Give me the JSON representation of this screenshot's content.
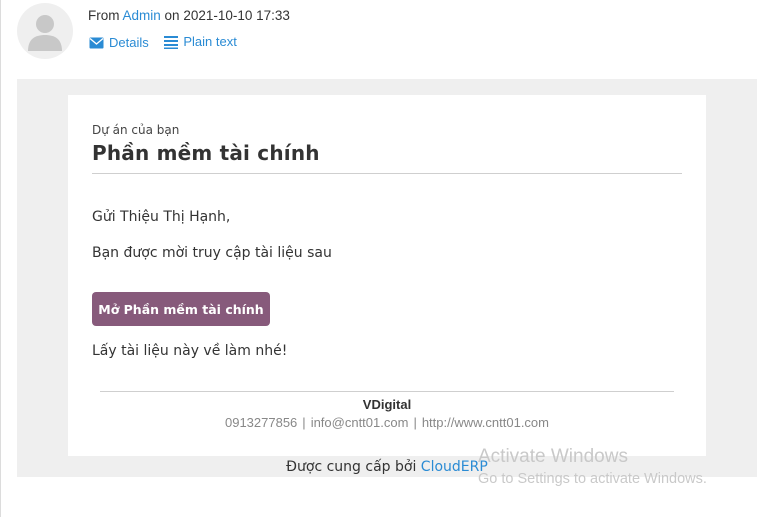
{
  "header": {
    "from_prefix": "From",
    "author": "Admin",
    "on_word": "on",
    "timestamp": "2021-10-10 17:33",
    "details_label": "Details",
    "details_icon": "envelope-icon",
    "plaintext_label": "Plain text",
    "plaintext_icon": "lines-icon",
    "link_color": "#2a8bd4"
  },
  "email": {
    "project_label": "Dự án của bạn",
    "project_title": "Phần mềm tài chính",
    "greeting": "Gửi Thiệu Thị Hạnh,",
    "invite_text": "Bạn được mời truy cập tài liệu sau",
    "open_button_label": "Mở Phần mềm tài chính",
    "button_color": "#875a7b",
    "closing_text": "Lấy tài liệu này về làm nhé!",
    "company_name": "VDigital",
    "phone": "0913277856",
    "email": "info@cntt01.com",
    "website": "http://www.cntt01.com",
    "separator": "|"
  },
  "footer": {
    "powered_prefix": "Được cung cấp bởi",
    "powered_brand": "CloudERP"
  },
  "watermark": {
    "title": "Activate Windows",
    "subtitle": "Go to Settings to activate Windows."
  }
}
